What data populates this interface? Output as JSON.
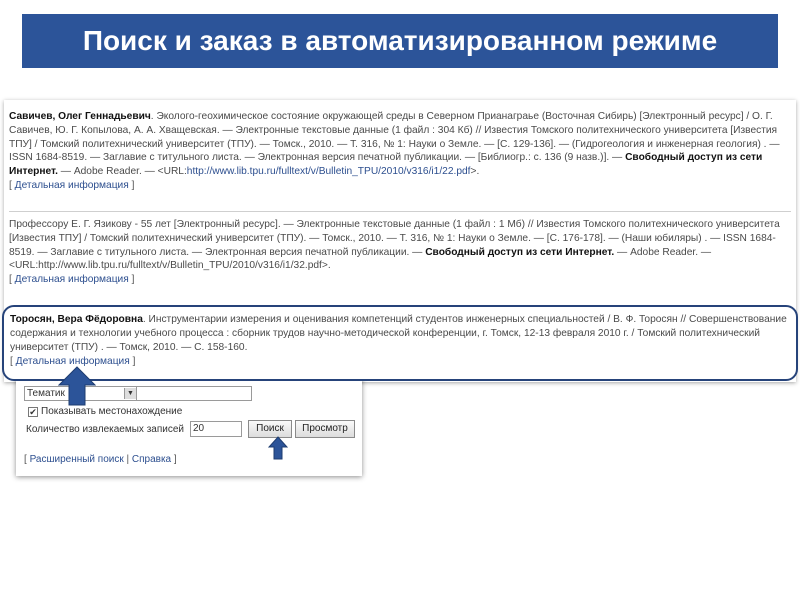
{
  "slide": {
    "title": "Поиск и заказ в автоматизированном режиме"
  },
  "records": [
    {
      "author": "Савичев, Олег Геннадьевич",
      "text": ". Эколого-геохимическое состояние окружающей среды в Северном Прианаграье (Восточная Сибирь) [Электронный ресурс] / О. Г. Савичев, Ю. Г. Копылова, А. А. Хващевская. — Электронные текстовые данные (1 файл : 304 Кб) // Известия Томского политехнического университета [Известия ТПУ] / Томский политехнический университет (ТПУ). — Томск., 2010. — Т. 316, № 1: Науки о Земле. — [С. 129-136]. — (Гидрогеология и инженерная геология) . — ISSN 1684-8519. — Заглавие с титульного листа. — Электронная версия печатной публикации. — [Библиогр.: с. 136 (9 назв.)]. — ",
      "access": "Свободный доступ из сети Интернет.",
      "after_access": " — Adobe Reader. — <URL:",
      "url": "http://www.lib.tpu.ru/fulltext/v/Bulletin_TPU/2010/v316/i1/22.pdf",
      "url_end": ">.",
      "detail": "Детальная информация"
    },
    {
      "text": "Профессору Е. Г. Язикову - 55 лет [Электронный ресурс]. — Электронные текстовые данные (1 файл : 1 Мб) // Известия Томского политехнического университета [Известия ТПУ] / Томский политехнический университет (ТПУ). — Томск., 2010. — Т. 316, № 1: Науки о Земле. — [С. 176-178]. — (Наши юбиляры) . — ISSN 1684-8519. — Заглавие с титульного листа. — Электронная версия печатной публикации. — ",
      "access": "Свободный доступ из сети Интернет.",
      "after_access": " — Adobe Reader. — <URL:http://www.lib.tpu.ru/fulltext/v/Bulletin_TPU/2010/v316/i1/32.pdf>.",
      "detail": "Детальная информация"
    },
    {
      "author": "Торосян, Вера Фёдоровна",
      "text": ". Инструментарии измерения и оценивания компетенций студентов инженерных специальностей / В. Ф. Торосян // Совершенствование содержания и технологии учебного процесса : сборник трудов научно-методической конференции, г. Томск, 12-13 февраля 2010 г. / Томский политехнический университет (ТПУ) . — Томск, 2010. — С. 158-160.",
      "detail": "Детальная информация"
    }
  ],
  "search_form": {
    "theme_value": "Тематик",
    "show_location_label": "Показывать местонахождение",
    "show_location_checked": true,
    "count_label": "Количество извлекаемых записей",
    "count_value": "20",
    "search_button": "Поиск",
    "browse_button": "Просмотр",
    "advanced_search": "Расширенный поиск",
    "help": "Справка"
  },
  "colors": {
    "title_bg": "#2c5499",
    "highlight_border": "#26437a",
    "link": "#2d4f8f",
    "arrow": "#2c5499"
  }
}
